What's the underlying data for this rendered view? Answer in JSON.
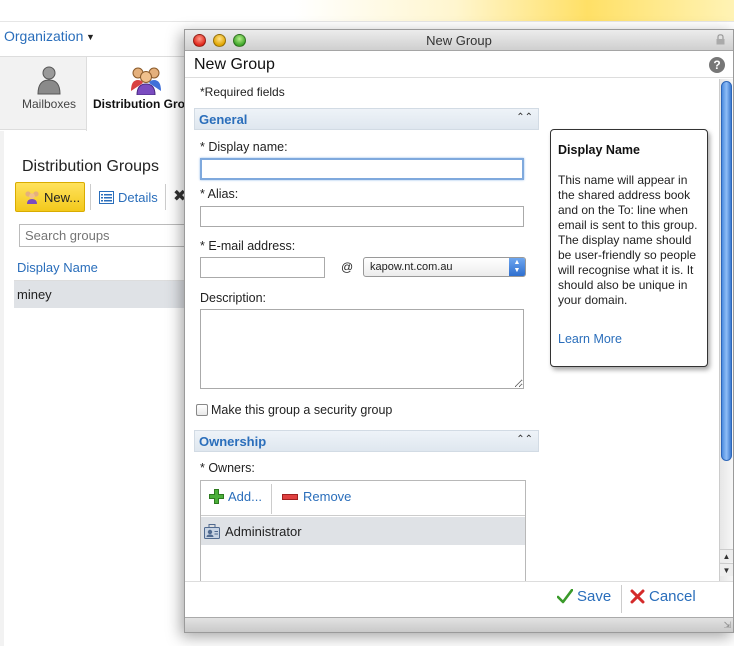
{
  "background": {
    "org_link": "Organization",
    "nav": {
      "mailboxes_label": "Mailboxes",
      "distribution_groups_label": "Distribution Gro"
    },
    "section_title": "Distribution Groups",
    "toolbar": {
      "new_label": "New...",
      "details_label": "Details"
    },
    "search_placeholder": "Search groups",
    "list_header": "Display Name",
    "rows": [
      "miney"
    ]
  },
  "dialog": {
    "window_title": "New Group",
    "title": "New Group",
    "help_icon": "?",
    "required_note": "*Required fields",
    "sections": {
      "general": "General",
      "ownership": "Ownership"
    },
    "fields": {
      "display_name_label": "* Display name:",
      "display_name_value": "",
      "alias_label": "* Alias:",
      "alias_value": "",
      "email_label": "* E-mail address:",
      "email_value": "",
      "at_sign": "@",
      "domain_selected": "kapow.nt.com.au",
      "description_label": "Description:",
      "description_value": "",
      "security_group_label": "Make this group a security group",
      "security_group_checked": false,
      "owners_label": "* Owners:",
      "owners_add": "Add...",
      "owners_remove": "Remove",
      "owners": [
        "Administrator"
      ]
    },
    "tooltip": {
      "title": "Display Name",
      "body": "This name will appear in the shared address book and on the To: line when email is sent to this group. The display name should be user-friendly so people will recognise what it is. It should also be unique in your domain.",
      "link": "Learn More"
    },
    "footer": {
      "save_label": "Save",
      "cancel_label": "Cancel"
    }
  },
  "colors": {
    "link_blue": "#2a6ebb",
    "new_button_yellow": "#f3c91b",
    "selected_row": "#dfe2e6"
  },
  "icons": [
    "chevron-down-icon",
    "mailbox-user-icon",
    "group-icon",
    "details-icon",
    "lock-icon",
    "help-icon",
    "collapse-icon",
    "add-icon",
    "remove-icon",
    "user-card-icon",
    "check-icon",
    "cancel-x-icon"
  ]
}
